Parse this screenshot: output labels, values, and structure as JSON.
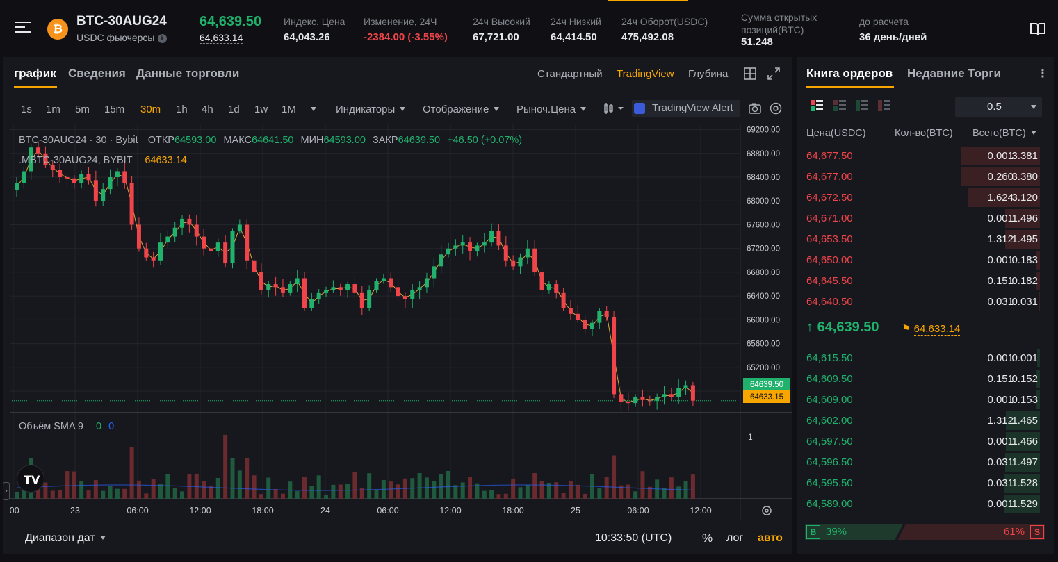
{
  "header": {
    "symbol": "BTC-30AUG24",
    "subtitle": "USDC фьючерсы",
    "coin_glyph": "₿",
    "last_price": "64,639.50",
    "mark_price": "64,633.14",
    "stats": [
      {
        "label": "Индекс. Цена",
        "value": "64,043.26",
        "color": "#e6e8ea"
      },
      {
        "label": "Изменение, 24Ч",
        "value": "-2384.00 (-3.55%)",
        "color": "#ef454a"
      },
      {
        "label": "24ч Высокий",
        "value": "67,721.00",
        "color": "#e6e8ea"
      },
      {
        "label": "24ч Низкий",
        "value": "64,414.50",
        "color": "#e6e8ea"
      },
      {
        "label": "24ч Оборот(USDC)",
        "value": "475,492.08",
        "color": "#e6e8ea"
      },
      {
        "label": "Сумма открытых позиций(BTC)",
        "value": "51.248",
        "color": "#e6e8ea"
      },
      {
        "label": "до расчета",
        "value": "36 день/дней",
        "color": "#e6e8ea"
      }
    ]
  },
  "chart_tabs": [
    "график",
    "Сведения",
    "Данные торговли"
  ],
  "view_modes": [
    "Стандартный",
    "TradingView",
    "Глубина"
  ],
  "timeframes": [
    "1s",
    "1m",
    "5m",
    "15m",
    "30m",
    "1h",
    "4h",
    "1d",
    "1w",
    "1M"
  ],
  "active_timeframe": "30m",
  "toolbar": {
    "indicators": "Индикаторы",
    "display": "Отображение",
    "price_type": "Рыноч.Цена",
    "alert": "TradingView Alert"
  },
  "legend": {
    "line1_symbol": "BTC-30AUG24 · 30 · Bybit",
    "open_label": "ОТКР",
    "open": "64593.00",
    "high_label": "МАКС",
    "high": "64641.50",
    "low_label": "МИН",
    "low": "64593.00",
    "close_label": "ЗАКР",
    "close": "64639.50",
    "change": "+46.50 (+0.07%)",
    "line2_symbol": ".MBTC-30AUG24, BYBIT",
    "line2_value": "64633.14",
    "volume_label": "Объём SMA 9",
    "volume_v1": "0",
    "volume_v2": "0",
    "volume_axis_label": "1"
  },
  "price_tags": {
    "last": "64639.50",
    "mark": "64633.15"
  },
  "footer": {
    "date_range": "Диапазон дат",
    "time": "10:33:50 (UTC)",
    "percent": "%",
    "log": "лог",
    "auto": "авто"
  },
  "colors": {
    "up": "#20b26c",
    "down": "#ef454a",
    "accent": "#f7a600",
    "bg": "#17181e"
  },
  "chart_data": {
    "type": "candlestick",
    "symbol": "BTC-30AUG24",
    "interval": "30m",
    "y_ticks": [
      69200,
      68800,
      68400,
      68000,
      67600,
      67200,
      66800,
      66400,
      66000,
      65600,
      65200,
      64800
    ],
    "ylim": [
      64450,
      69300
    ],
    "x_tick_labels": [
      ":00",
      "23",
      "06:00",
      "12:00",
      "18:00",
      "24",
      "06:00",
      "12:00",
      "18:00",
      "25",
      "06:00",
      "12:00"
    ],
    "close_approx": [
      68300,
      68500,
      68900,
      68800,
      68600,
      68520,
      68400,
      68380,
      68300,
      68450,
      68350,
      68000,
      68200,
      68400,
      68500,
      68300,
      67600,
      67200,
      67050,
      67000,
      67300,
      67400,
      67550,
      67700,
      67600,
      67400,
      67200,
      67150,
      67300,
      66950,
      67500,
      67600,
      67000,
      66800,
      66500,
      66600,
      66550,
      66450,
      66600,
      66700,
      66200,
      66350,
      66450,
      66500,
      66550,
      66500,
      66600,
      66450,
      66200,
      66500,
      66650,
      66700,
      66550,
      66400,
      66350,
      66500,
      66550,
      66700,
      66900,
      67100,
      67200,
      67250,
      67300,
      67150,
      67250,
      67300,
      67500,
      67250,
      67000,
      66900,
      67050,
      67200,
      66800,
      66500,
      66600,
      66450,
      66200,
      66100,
      66000,
      65850,
      65950,
      66150,
      66050,
      64750,
      64620,
      64600,
      64700,
      64650,
      64640,
      64700,
      64750,
      64700,
      64850,
      64900,
      64640
    ],
    "volume_sma": 9
  }
}
